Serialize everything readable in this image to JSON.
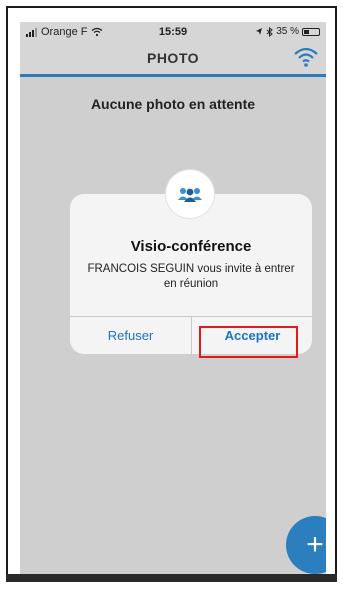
{
  "status_bar": {
    "carrier": "Orange F",
    "time": "15:59",
    "battery_text": "35 %",
    "battery_level": 0.35
  },
  "nav": {
    "title": "PHOTO"
  },
  "main": {
    "empty_message": "Aucune photo en attente"
  },
  "dialog": {
    "title": "Visio-conférence",
    "message": "FRANCOIS SEGUIN vous invite à entrer en réunion",
    "refuse_label": "Refuser",
    "accept_label": "Accepter"
  },
  "fab": {
    "label": "+"
  },
  "colors": {
    "accent": "#2c7fbe",
    "link": "#1a73c6",
    "highlight": "#e01b1b"
  },
  "icons": {
    "nav_right": "wifi-icon",
    "dialog": "people-icon",
    "fab": "plus-icon"
  }
}
